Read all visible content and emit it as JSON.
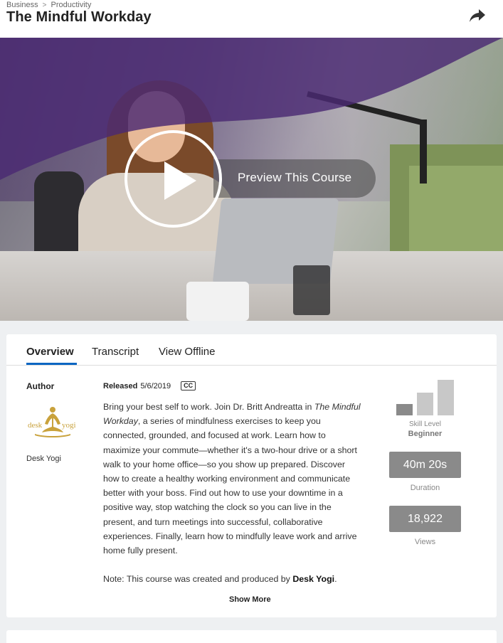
{
  "header": {
    "breadcrumb": [
      "Business",
      "Productivity"
    ],
    "breadcrumb_separator": ">",
    "title": "The Mindful Workday",
    "share_icon": "share-arrow-icon"
  },
  "hero": {
    "play_icon": "play-icon",
    "preview_label": "Preview This Course"
  },
  "tabs": [
    {
      "label": "Overview",
      "active": true
    },
    {
      "label": "Transcript",
      "active": false
    },
    {
      "label": "View Offline",
      "active": false
    }
  ],
  "author": {
    "heading": "Author",
    "logo_text_left": "desk",
    "logo_text_right": "yogi",
    "name": "Desk Yogi"
  },
  "release": {
    "label": "Released",
    "date": "5/6/2019",
    "cc_badge": "CC"
  },
  "description": {
    "lines": [
      {
        "text": "Bring your best self to work. Join Dr. Britt Andreatta in "
      },
      {
        "text": "The",
        "italic": true
      },
      {
        "text": "Mindful Workday",
        "italic": true
      },
      {
        "text": ", a series of mindfulness exercises to keep you connected, grounded, and focused at work. Learn how to maximize your commute—whether it's a two-hour drive or a short walk to your home office—so you show up prepared. Discover how to create a healthy working environment and communicate better with your boss. Find out how to use your downtime in a positive way, stop watching the clock so you can live in the present, and turn meetings into successful, collaborative experiences. Finally, learn how to mindfully leave work and arrive home fully present."
      }
    ],
    "note_prefix": "Note: This course was created and produced by ",
    "note_author": "Desk Yogi",
    "note_suffix": ".",
    "show_more": "Show More"
  },
  "stats": {
    "skill_level_label": "Skill Level",
    "skill_level_value": "Beginner",
    "skill_level_filled": 1,
    "skill_level_total": 3,
    "duration": "40m 20s",
    "duration_label": "Duration",
    "views": "18,922",
    "views_label": "Views"
  },
  "colors": {
    "accent": "#0a66c2",
    "stat_box": "#8a8a8a",
    "bar_filled": "#8a8a8a",
    "bar_empty": "#c8c8c8",
    "hero_purple": "#4a2a73",
    "logo_gold": "#c9a23c"
  }
}
